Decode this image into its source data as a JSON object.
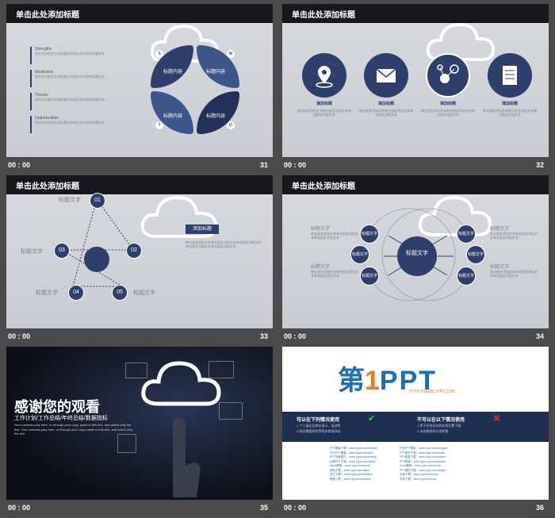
{
  "slides": [
    {
      "num": "31",
      "meta": "00 : 00",
      "title": "单击此处添加标题",
      "swot": [
        {
          "h": "Strengths",
          "t": "研究文本研究文本标题文本研究文本研究标题文本"
        },
        {
          "h": "Weakness",
          "t": "研究文本研究文本标题文本研究文本研究标题文本"
        },
        {
          "h": "Threats",
          "t": "研究文本研究文本标题文本研究文本研究标题文本"
        },
        {
          "h": "Opportunities",
          "t": "研究文本研究文本标题文本研究文本研究标题文本"
        }
      ],
      "petal": "标题内容",
      "letters": [
        "S",
        "W",
        "T",
        "O"
      ]
    },
    {
      "num": "32",
      "meta": "00 : 00",
      "title": "单击此处添加标题",
      "items": [
        {
          "label": "填加标题",
          "text": "单击此处添加文本单击此处添加文本单击此处添加文本"
        },
        {
          "label": "填加标题",
          "text": "单击此处添加文本单击此处添加文本单击此处添加文本"
        },
        {
          "label": "填加标题",
          "text": "单击此处添加文本单击此处添加文本单击此处添加文本"
        },
        {
          "label": "填加标题",
          "text": "单击此处添加文本单击此处添加文本单击此处添加文本"
        }
      ]
    },
    {
      "num": "33",
      "meta": "00 : 00",
      "title": "单击此处添加标题",
      "nodes": [
        "01",
        "02",
        "03",
        "04",
        "05"
      ],
      "node_label": "标题文字",
      "add_title": "添加标题",
      "para": "单击此处添加文本单击此处添加文本单击此处添加文本单击此处添加文本单击此处添加文本"
    },
    {
      "num": "34",
      "meta": "00 : 00",
      "title": "单击此处添加标题",
      "center": "标题文字",
      "node_label": "标题文字",
      "side": "标题文字",
      "para": "单击此处添加文本单击此处添加文本单击此处添加文本"
    },
    {
      "num": "35",
      "meta": "00 : 00",
      "thanks": "感谢您的观看",
      "subtitle": "工作计划/工作总结/年终总结/数据指标",
      "body": "Your contents play here, or through your copy, paste in this box, and select only the text. Your contents play here, or through your copy, paste in this box, and select only the text."
    },
    {
      "num": "36",
      "meta": "00 : 00",
      "logo_a": "第",
      "logo_b": "1",
      "logo_c": "PPT",
      "url": "HTTP://WWW.1PPT.COM",
      "can": "可以在下列情况使用",
      "cannot": "不可以在以下情况使用",
      "can_lines": [
        "1.个人或企业商业演示、培训等",
        "2.网页模版制作等等非商用网站"
      ],
      "cannot_lines": [
        "1.用于任何形式的在线付费下载",
        "2.未经授权的分享转载"
      ],
      "links": [
        "PPT模板下载：www.1ppt.com/moban/",
        "节日PPT模板：www.1ppt.com/jieri/",
        "PPT背景图片：www.1ppt.com/beijing/",
        "优秀PPT下载：www.1ppt.com/xiazai/",
        "Word教程：www.1ppt.com/word/",
        "资料下载：www.1ppt.com/ziliao/",
        "范文下载：www.1ppt.com/fanwen/",
        "教案下载：www.1ppt.com/jiaoan/"
      ],
      "links2": [
        "行业PPT模板：www.1ppt.com/hangye/",
        "PPT素材下载：www.1ppt.com/sucai/",
        "PPT图表下载：www.1ppt.com/tubiao/",
        "PPT教程：www.1ppt.com/powerpoint/",
        "Excel教程：www.1ppt.com/excel/",
        "PPT课件下载：www.1ppt.com/kejian/",
        "试卷下载：www.1ppt.com/shiti/",
        "字体下载：www.1ppt.com/ziti/"
      ]
    }
  ]
}
